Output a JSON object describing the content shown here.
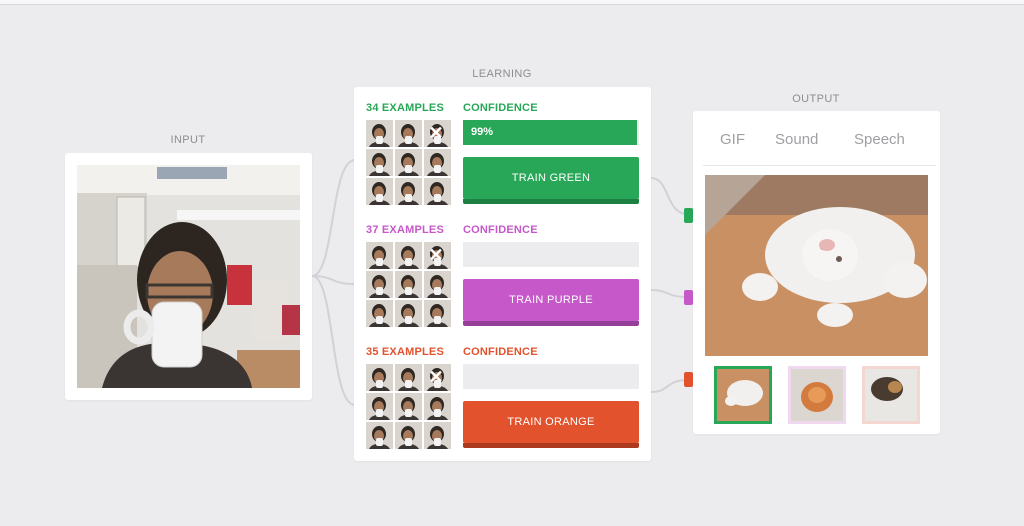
{
  "colors": {
    "green": "#27a757",
    "purple": "#c658c9",
    "orange": "#e2522d",
    "link": "#3b7fd6"
  },
  "input": {
    "label": "INPUT"
  },
  "learning": {
    "label": "LEARNING",
    "classes": [
      {
        "examples": "34 EXAMPLES",
        "confidence_label": "CONFIDENCE",
        "confidence": 0.99,
        "confidence_text": "99%",
        "train_label": "TRAIN GREEN"
      },
      {
        "examples": "37 EXAMPLES",
        "confidence_label": "CONFIDENCE",
        "confidence": 0,
        "confidence_text": "",
        "train_label": "TRAIN PURPLE"
      },
      {
        "examples": "35 EXAMPLES",
        "confidence_label": "CONFIDENCE",
        "confidence": 0,
        "confidence_text": "",
        "train_label": "TRAIN ORANGE"
      }
    ],
    "clear_icon": "close-icon"
  },
  "output": {
    "label": "OUTPUT",
    "tabs": [
      {
        "label": "GIF",
        "active": true
      },
      {
        "label": "Sound",
        "active": false
      },
      {
        "label": "Speech",
        "active": false
      }
    ],
    "selected_thumb": 0
  }
}
